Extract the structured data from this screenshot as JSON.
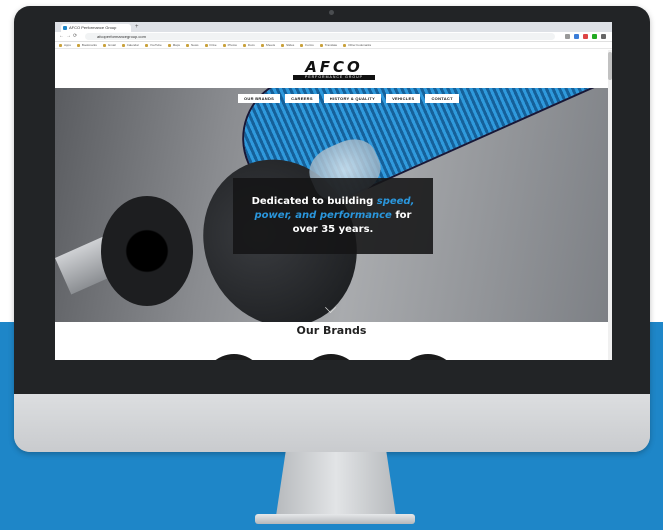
{
  "browser": {
    "tab_title": "AFCO Performance Group",
    "tab_new": "+",
    "url": "afcoperformancegroup.com",
    "nav": {
      "back": "←",
      "forward": "→",
      "reload": "⟳"
    },
    "bookmarks": [
      "Apps",
      "Bookmarks",
      "Gmail",
      "Calendar",
      "YouTube",
      "Maps",
      "News",
      "Drive",
      "Photos",
      "Docs",
      "Sheets",
      "Slides",
      "Forms",
      "Translate",
      "Other bookmarks"
    ]
  },
  "site": {
    "logo": "AFCO",
    "logo_sub": "PERFORMANCE GROUP",
    "nav": [
      "OUR BRANDS",
      "CAREERS",
      "HISTORY & QUALITY",
      "VEHICLES",
      "CONTACT"
    ],
    "hero": {
      "pre": "Dedicated to building ",
      "hl": "speed, power, and performance",
      "post": " for over 35 years."
    },
    "section_title": "Our Brands"
  },
  "colors": {
    "accent": "#2a96dc",
    "band": "#1e86c8"
  }
}
